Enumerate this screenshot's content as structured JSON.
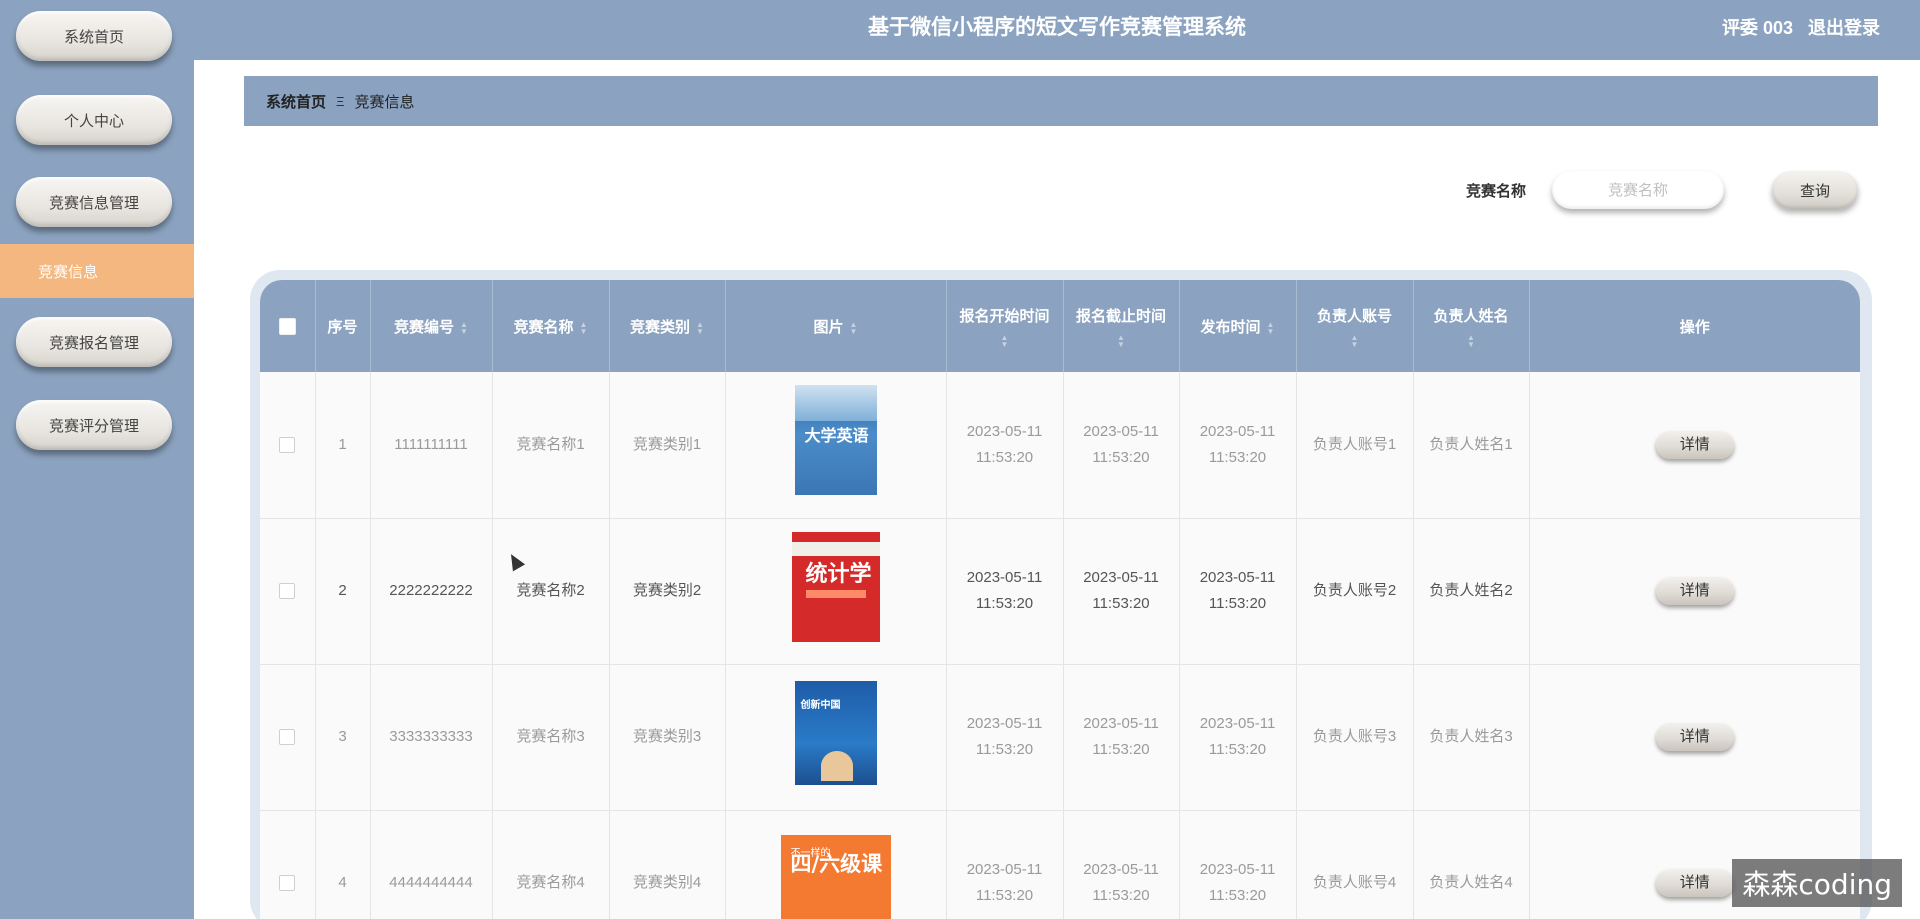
{
  "header": {
    "title": "基于微信小程序的短文写作竞赛管理系统",
    "user": "评委 003",
    "logout": "退出登录"
  },
  "sidebar": {
    "items": [
      {
        "label": "系统首页"
      },
      {
        "label": "个人中心"
      },
      {
        "label": "竞赛信息管理"
      },
      {
        "label": "竞赛信息",
        "active": true
      },
      {
        "label": "竞赛报名管理"
      },
      {
        "label": "竞赛评分管理"
      }
    ]
  },
  "breadcrumb": {
    "home": "系统首页",
    "separator": "Ξ",
    "current": "竞赛信息"
  },
  "search": {
    "label": "竞赛名称",
    "placeholder": "竞赛名称",
    "button": "查询"
  },
  "table": {
    "columns": [
      "序号",
      "竞赛编号",
      "竞赛名称",
      "竞赛类别",
      "图片",
      "报名开始时间",
      "报名截止时间",
      "发布时间",
      "负责人账号",
      "负责人姓名",
      "操作"
    ],
    "action_label": "详情",
    "rows": [
      {
        "index": "1",
        "code": "1111111111",
        "name": "竞赛名称1",
        "category": "竞赛类别1",
        "start": "2023-05-11",
        "start_time": "11:53:20",
        "end": "2023-05-11",
        "end_time": "11:53:20",
        "publish": "2023-05-11",
        "publish_time": "11:53:20",
        "account": "负责人账号1",
        "person": "负责人姓名1",
        "cover_title": "大学英语"
      },
      {
        "index": "2",
        "code": "2222222222",
        "name": "竞赛名称2",
        "category": "竞赛类别2",
        "start": "2023-05-11",
        "start_time": "11:53:20",
        "end": "2023-05-11",
        "end_time": "11:53:20",
        "publish": "2023-05-11",
        "publish_time": "11:53:20",
        "account": "负责人账号2",
        "person": "负责人姓名2",
        "cover_title": "统计学"
      },
      {
        "index": "3",
        "code": "3333333333",
        "name": "竞赛名称3",
        "category": "竞赛类别3",
        "start": "2023-05-11",
        "start_time": "11:53:20",
        "end": "2023-05-11",
        "end_time": "11:53:20",
        "publish": "2023-05-11",
        "publish_time": "11:53:20",
        "account": "负责人账号3",
        "person": "负责人姓名3",
        "cover_title": "创新中国"
      },
      {
        "index": "4",
        "code": "4444444444",
        "name": "竞赛名称4",
        "category": "竞赛类别4",
        "start": "2023-05-11",
        "start_time": "11:53:20",
        "end": "2023-05-11",
        "end_time": "11:53:20",
        "publish": "2023-05-11",
        "publish_time": "11:53:20",
        "account": "负责人账号4",
        "person": "负责人姓名4",
        "cover_title": "四/六级课",
        "cover_subtitle": "不一样的"
      }
    ]
  },
  "watermark": "森森coding",
  "colors": {
    "primary": "#8ba3c0",
    "active_nav": "#f3b77f",
    "table_frame": "#dfe8f1"
  }
}
